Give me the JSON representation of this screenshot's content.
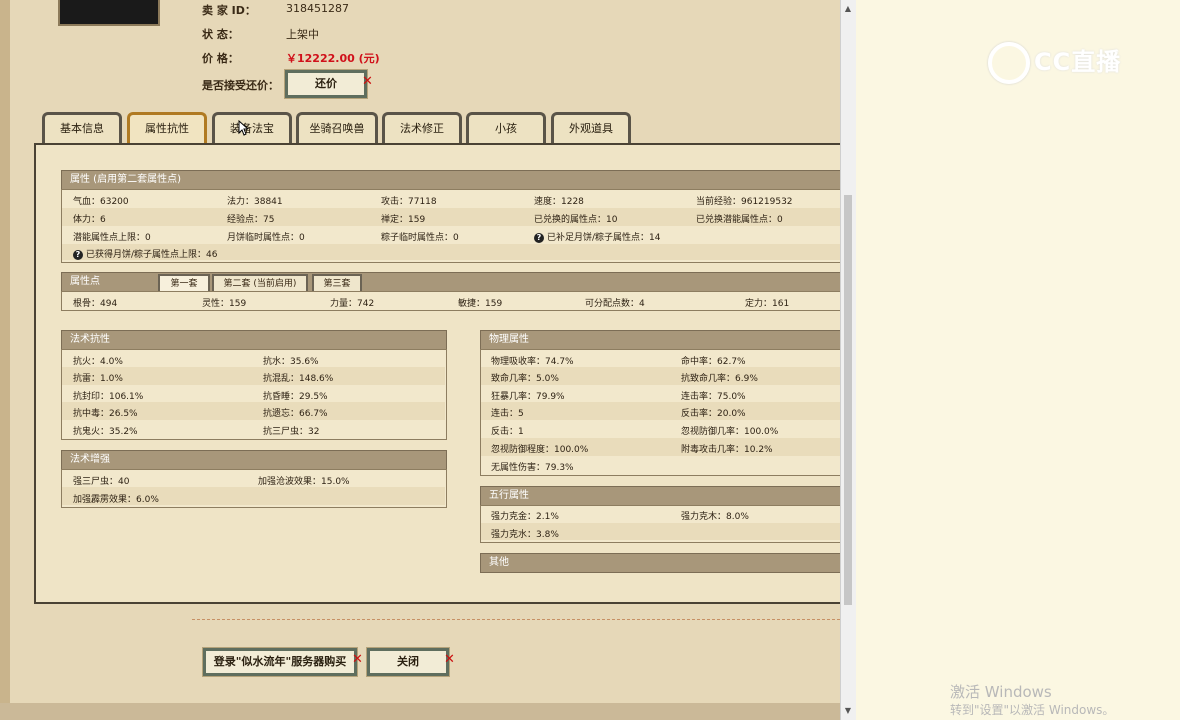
{
  "seller": {
    "id_label": "卖  家    ID：",
    "id_value": "318451287",
    "status_label": "状        态：",
    "status_value": "上架中",
    "price_label": "价        格：",
    "price_value": "￥12222.00 (元)",
    "bargain_label": "是否接受还价：",
    "bargain_button": "还价"
  },
  "tabs": [
    "基本信息",
    "属性抗性",
    "装备法宝",
    "坐骑召唤兽",
    "法术修正",
    "小孩",
    "外观道具"
  ],
  "attributes": {
    "title": "属性 (启用第二套属性点)",
    "rows": [
      [
        "气血：63200",
        "法力：38841",
        "攻击：77118",
        "速度：1228",
        "当前经验：961219532"
      ],
      [
        "体力：6",
        "经验点：75",
        "禅定：159",
        "已兑换的属性点：10",
        "已兑换潜能属性点：0"
      ],
      [
        "潜能属性点上限：0",
        "月饼临时属性点：0",
        "粽子临时属性点：0",
        "已补足月饼/粽子属性点：14",
        ""
      ]
    ],
    "note": "已获得月饼/粽子属性点上限：46"
  },
  "points": {
    "title": "属性点",
    "subtabs": [
      "第一套",
      "第二套 (当前启用)",
      "第三套"
    ],
    "values": [
      "根骨：494",
      "灵性：159",
      "力量：742",
      "敏捷：159",
      "可分配点数：4",
      "定力：161"
    ]
  },
  "magic_resist": {
    "title": "法术抗性",
    "rows": [
      [
        "抗火：4.0%",
        "抗水：35.6%"
      ],
      [
        "抗雷：1.0%",
        "抗混乱：148.6%"
      ],
      [
        "抗封印：106.1%",
        "抗昏睡：29.5%"
      ],
      [
        "抗中毒：26.5%",
        "抗遗忘：66.7%"
      ],
      [
        "抗鬼火：35.2%",
        "抗三尸虫：32"
      ]
    ]
  },
  "magic_boost": {
    "title": "法术增强",
    "rows": [
      [
        "强三尸虫：40",
        "加强沧波效果：15.0%"
      ],
      [
        "加强霹雳效果：6.0%",
        ""
      ]
    ]
  },
  "physical": {
    "title": "物理属性",
    "rows": [
      [
        "物理吸收率：74.7%",
        "命中率：62.7%"
      ],
      [
        "致命几率：5.0%",
        "抗致命几率：6.9%"
      ],
      [
        "狂暴几率：79.9%",
        "连击率：75.0%"
      ],
      [
        "连击：5",
        "反击率：20.0%"
      ],
      [
        "反击：1",
        "忽视防御几率：100.0%"
      ],
      [
        "忽视防御程度：100.0%",
        "附毒攻击几率：10.2%"
      ],
      [
        "无属性伤害：79.3%",
        ""
      ]
    ]
  },
  "elements": {
    "title": "五行属性",
    "rows": [
      [
        "强力克金：2.1%",
        "强力克木：8.0%"
      ],
      [
        "强力克水：3.8%",
        ""
      ]
    ]
  },
  "other": {
    "title": "其他"
  },
  "footer": {
    "buy_button": "登录\"似水流年\"服务器购买",
    "close_button": "关闭"
  },
  "overlay": {
    "logo_text": "CC直播",
    "activate_title": "激活 Windows",
    "activate_sub": "转到\"设置\"以激活 Windows。"
  }
}
